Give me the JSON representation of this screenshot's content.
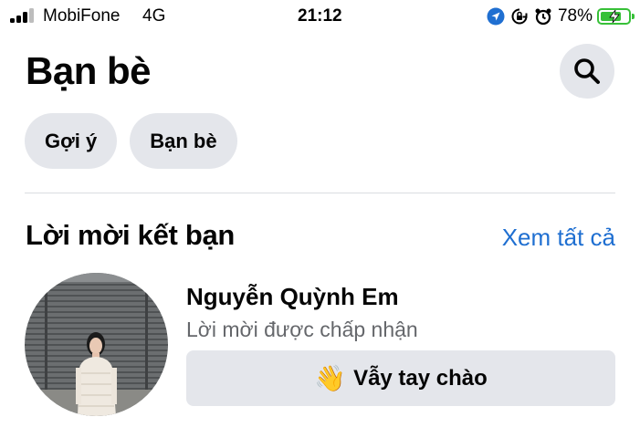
{
  "status_bar": {
    "carrier": "MobiFone",
    "network": "4G",
    "time": "21:12",
    "battery_percent": "78%",
    "battery_level": 0.78,
    "icons": [
      "location-arrow-icon",
      "rotation-lock-icon",
      "alarm-icon",
      "battery-charging-icon"
    ]
  },
  "header": {
    "title": "Bạn bè",
    "search_icon": "search-icon"
  },
  "chips": [
    {
      "label": "Gợi ý"
    },
    {
      "label": "Bạn bè"
    }
  ],
  "section": {
    "title": "Lời mời kết bạn",
    "see_all": "Xem tất cả"
  },
  "requests": [
    {
      "name": "Nguyễn Quỳnh Em",
      "status": "Lời mời được chấp nhận",
      "button_emoji": "👋",
      "button_label": "Vẫy tay chào"
    }
  ],
  "colors": {
    "link_blue": "#1f6fd1",
    "chip_bg": "#e4e6eb",
    "secondary_text": "#65676b",
    "battery_green": "#37c038"
  }
}
